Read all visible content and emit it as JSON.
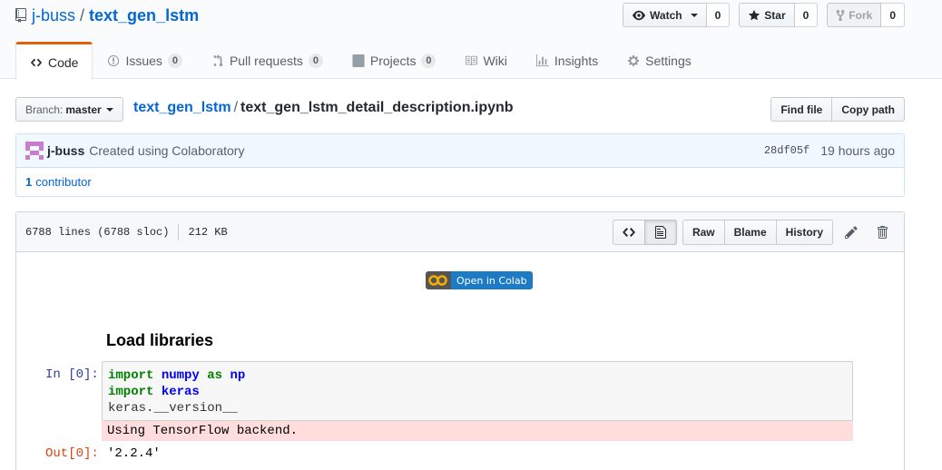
{
  "repo": {
    "owner": "j-buss",
    "separator": "/",
    "name": "text_gen_lstm"
  },
  "actions": {
    "watch": {
      "label": "Watch",
      "count": "0"
    },
    "star": {
      "label": "Star",
      "count": "0"
    },
    "fork": {
      "label": "Fork",
      "count": "0"
    }
  },
  "tabs": [
    {
      "label": "Code",
      "icon": "code-icon"
    },
    {
      "label": "Issues",
      "count": "0",
      "icon": "issue-icon"
    },
    {
      "label": "Pull requests",
      "count": "0",
      "icon": "pull-request-icon"
    },
    {
      "label": "Projects",
      "count": "0",
      "icon": "project-icon"
    },
    {
      "label": "Wiki",
      "icon": "book-icon"
    },
    {
      "label": "Insights",
      "icon": "graph-icon"
    },
    {
      "label": "Settings",
      "icon": "gear-icon"
    }
  ],
  "file_nav": {
    "branch_prefix": "Branch:",
    "branch": "master",
    "breadcrumb_root": "text_gen_lstm",
    "breadcrumb_sep": "/",
    "filename": "text_gen_lstm_detail_description.ipynb",
    "find_file": "Find file",
    "copy_path": "Copy path"
  },
  "commit": {
    "author": "j-buss",
    "message": "Created using Colaboratory",
    "sha": "28df05f",
    "time_ago": "19 hours ago",
    "contributors_count": "1",
    "contributors_label": "contributor"
  },
  "file": {
    "lines": "6788 lines (6788 sloc)",
    "size": "212 KB",
    "raw": "Raw",
    "blame": "Blame",
    "history": "History"
  },
  "notebook": {
    "colab_badge": "Open in Colab",
    "heading": "Load libraries",
    "in_prompt": "In [0]:",
    "code_line1_kw": "import",
    "code_line1_mod": "numpy",
    "code_line1_as": "as",
    "code_line1_alias": "np",
    "code_line2_kw": "import",
    "code_line2_mod": "keras",
    "code_line3": "keras.__version__",
    "stderr": "Using TensorFlow backend.",
    "out_prompt": "Out[0]:",
    "out_value": "'2.2.4'"
  },
  "colors": {
    "link": "#0366d6",
    "tab_accent": "#e36209",
    "commit_bg": "#f1f8ff",
    "stderr_bg": "#ffdddd",
    "colab_blue": "#1d7ac4",
    "colab_orange": "#f9ab00"
  }
}
